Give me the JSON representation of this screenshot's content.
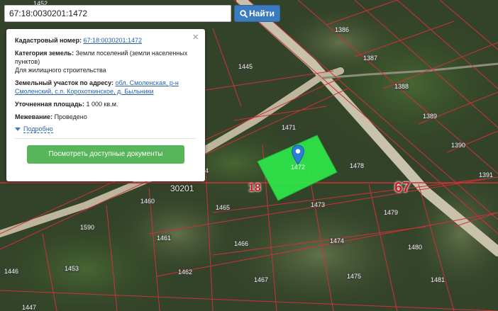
{
  "search": {
    "value": "67:18:0030201:1472",
    "button_label": "Найти"
  },
  "popup": {
    "cadastral_label": "Кадастровый номер:",
    "cadastral_value": "67:18:0030201:1472",
    "category_label": "Категория земель:",
    "category_value": "Земли поселений (земли населенных пунктов)",
    "usage_value": "Для жилищного строительства",
    "address_label": "Земельный участок по адресу:",
    "address_value": "обл. Смоленская, р-н Смоленский, с.п. Корохоткинское, д. Быльники",
    "area_label": "Уточненная площадь:",
    "area_value": "1 000 кв.м.",
    "survey_label": "Межевание:",
    "survey_value": "Проведено",
    "more_label": "Подробно",
    "docs_button": "Посмотреть доступные документы",
    "close_glyph": "×"
  },
  "map": {
    "region_labels": [
      "67",
      "18"
    ],
    "quarter_label": "30201",
    "selected_parcel_label": "1472",
    "parcel_numbers": [
      "1386",
      "1387",
      "1388",
      "1389",
      "1390",
      "1391",
      "1445",
      "1471",
      "1478",
      "1479",
      "1480",
      "1481",
      "1473",
      "1474",
      "1475",
      "1465",
      "1466",
      "1467",
      "1460",
      "1461",
      "1462",
      "1590",
      "1453",
      "1446",
      "1447",
      "1452",
      "4"
    ],
    "colors": {
      "selected_fill": "#2ee84a",
      "boundary": "#d0303a",
      "marker": "#2a7fd4",
      "search_button": "#3b7bbf",
      "docs_button": "#58b55a"
    },
    "marker_icon": "map-pin-icon"
  }
}
